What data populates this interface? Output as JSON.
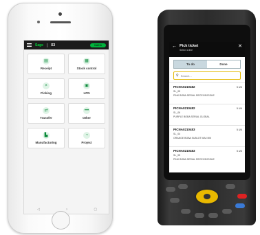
{
  "iphone": {
    "header": {
      "brand": "Sage",
      "app": "X3",
      "site": "NA011"
    },
    "tiles": [
      {
        "label": "Receipt",
        "icon": "receipt-icon",
        "glyph": "▤"
      },
      {
        "label": "Stock control",
        "icon": "stock-control-icon",
        "glyph": "▦"
      },
      {
        "label": "Picking",
        "icon": "picking-icon",
        "glyph": "◓"
      },
      {
        "label": "LPN",
        "icon": "lpn-icon",
        "glyph": "▣"
      },
      {
        "label": "Transfer",
        "icon": "transfer-icon",
        "glyph": "⇄"
      },
      {
        "label": "Other",
        "icon": "other-icon",
        "glyph": "•••"
      },
      {
        "label": "Manufacturing",
        "icon": "manufacturing-icon",
        "glyph": "▙"
      },
      {
        "label": "Project",
        "icon": "project-icon",
        "glyph": "◔"
      }
    ],
    "nav": {
      "back": "◁",
      "home": "○",
      "recent": "▢"
    }
  },
  "scanner": {
    "title": "Pick ticket",
    "subtitle": "Select a line",
    "tabs": {
      "todo": "To do",
      "done": "Done"
    },
    "search_placeholder": "Search...",
    "items": [
      {
        "id": "PICNA0210482",
        "qty": "5 UN",
        "loc": "SL_05",
        "desc": "PINK BOBA SERIAL RECEIVE/ISSUE"
      },
      {
        "id": "PICNA0210482",
        "qty": "5 UN",
        "loc": "SL_06",
        "desc": "PURPLE BOBA SERIAL GLOBAL"
      },
      {
        "id": "PICNA0210483",
        "qty": "5 UN",
        "loc": "SL_04",
        "desc": "ORANGE BOBA SUBLOT MAJ MN"
      },
      {
        "id": "PICNA0210483",
        "qty": "5 UN",
        "loc": "SL_05",
        "desc": "PINK BOBA SERIAL RECEIVE/ISSUE"
      }
    ]
  }
}
